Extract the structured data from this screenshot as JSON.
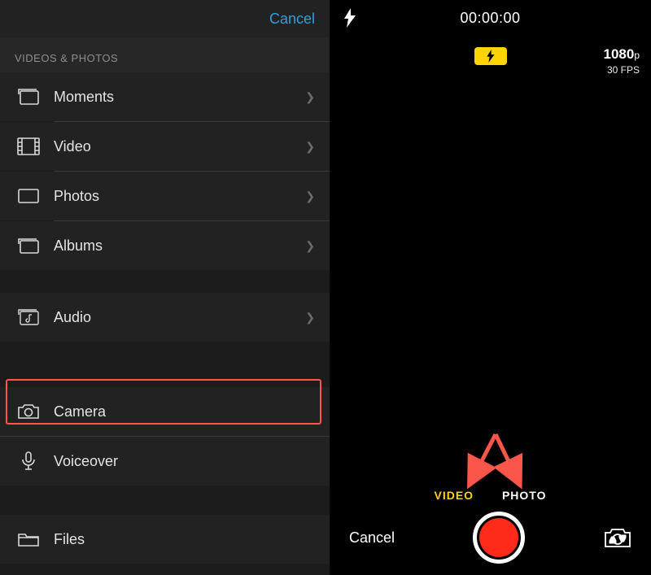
{
  "left": {
    "cancel": "Cancel",
    "section_header": "VIDEOS & PHOTOS",
    "items": {
      "moments": "Moments",
      "video": "Video",
      "photos": "Photos",
      "albums": "Albums",
      "audio": "Audio",
      "camera": "Camera",
      "voiceover": "Voiceover",
      "files": "Files"
    }
  },
  "right": {
    "timer": "00:00:00",
    "resolution": "1080",
    "resolution_suffix": "p",
    "fps": "30",
    "fps_label": "FPS",
    "modes": {
      "video": "VIDEO",
      "photo": "PHOTO"
    },
    "cancel": "Cancel"
  }
}
